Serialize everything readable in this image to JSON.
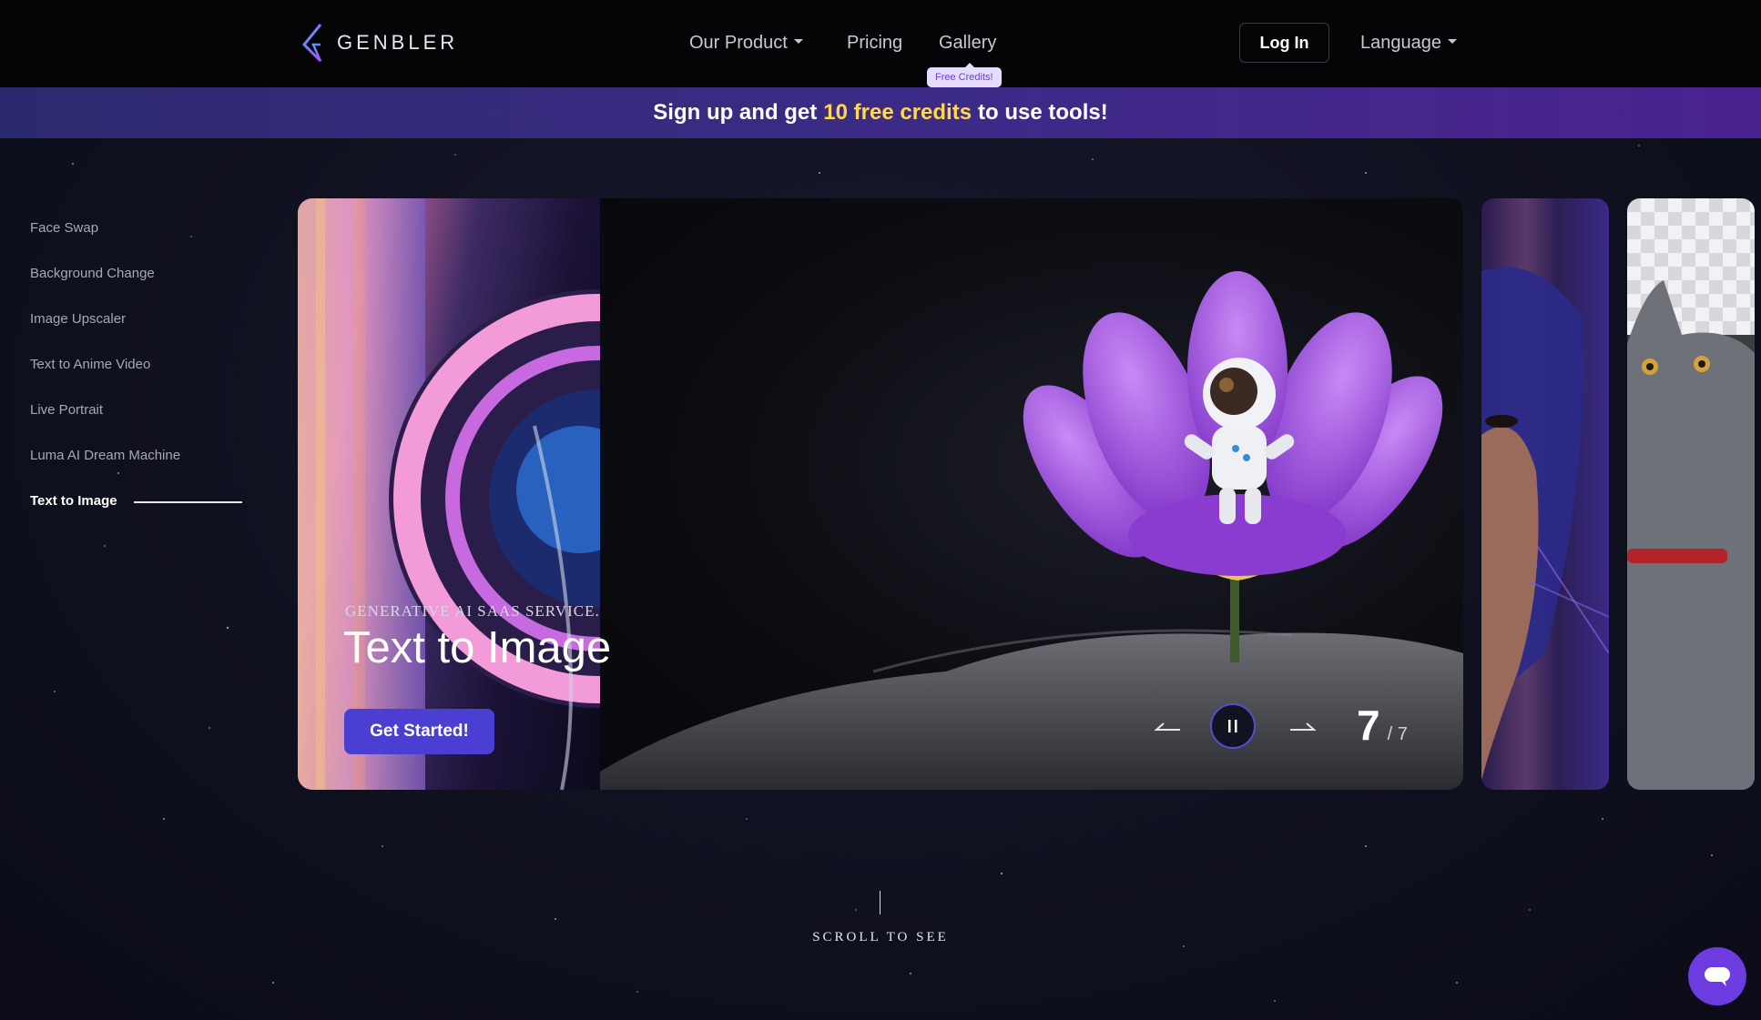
{
  "header": {
    "brand": "GENBLER",
    "nav": {
      "our_product": "Our Product",
      "pricing": "Pricing",
      "gallery": "Gallery",
      "gallery_badge": "Free Credits!"
    },
    "login": "Log In",
    "language": "Language"
  },
  "promo": {
    "prefix": "Sign up and get",
    "highlight": "10 free credits",
    "suffix": "to use tools!",
    "highlight_color": "#ffd84d"
  },
  "sidebar": {
    "items": [
      {
        "label": "Face Swap"
      },
      {
        "label": "Background Change"
      },
      {
        "label": "Image Upscaler"
      },
      {
        "label": "Text to Anime Video"
      },
      {
        "label": "Live Portrait"
      },
      {
        "label": "Luma AI Dream Machine"
      },
      {
        "label": "Text to Image"
      }
    ],
    "active_index": 6
  },
  "hero": {
    "kicker": "GENERATIVE AI SAAS SERVICE.",
    "title": "Text to Image",
    "cta": "Get Started!",
    "slide_current": "7",
    "slide_total": "/ 7"
  },
  "scroll_hint": "SCROLL TO SEE",
  "colors": {
    "accent": "#4b3fd3",
    "promo_gradient_start": "#2c2a6e",
    "promo_gradient_end": "#4a2290",
    "chat_button": "#6c3ce0"
  },
  "icons": {
    "prev": "arrow-left-icon",
    "next": "arrow-right-icon",
    "pause": "pause-icon",
    "chat": "chat-bubble-icon",
    "logo": "genbler-logo-icon"
  }
}
